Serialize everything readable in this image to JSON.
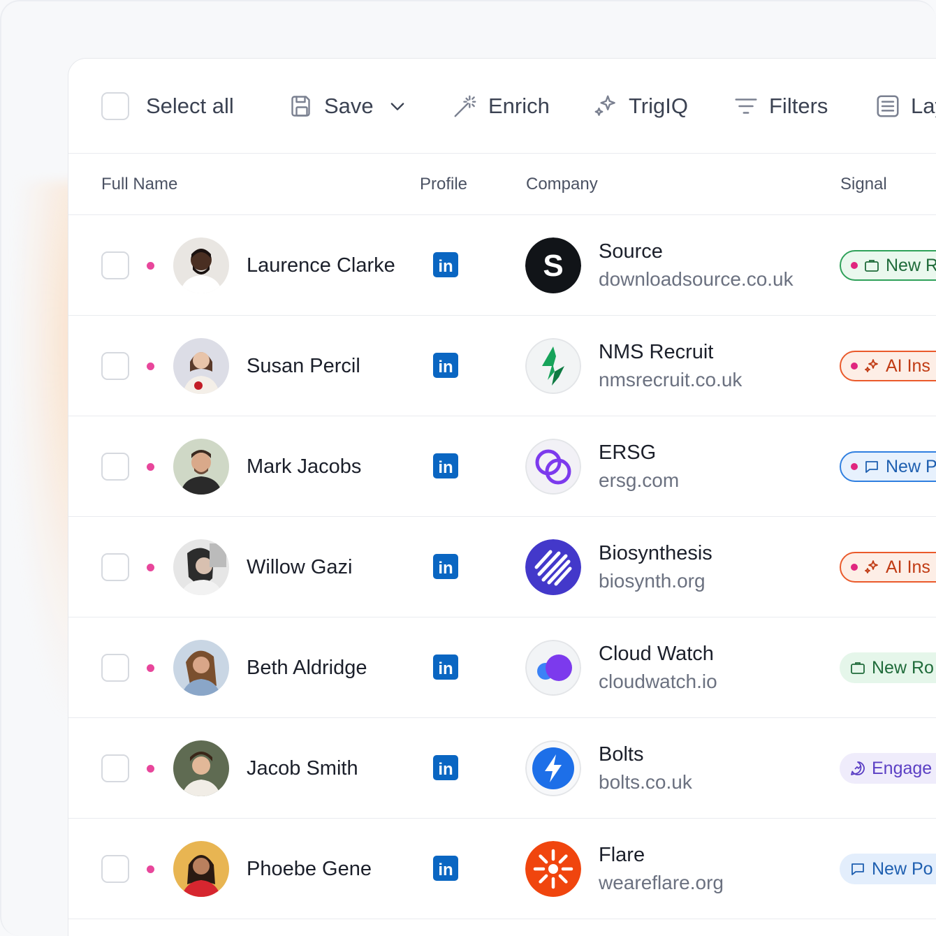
{
  "toolbar": {
    "select_all": "Select all",
    "save": "Save",
    "enrich": "Enrich",
    "trigiq": "TrigIQ",
    "filters": "Filters",
    "layout": "Lay"
  },
  "columns": {
    "full_name": "Full Name",
    "profile": "Profile",
    "company": "Company",
    "signal": "Signal"
  },
  "rows": [
    {
      "name": "Laurence Clarke",
      "company": "Source",
      "domain": "downloadsource.co.uk",
      "signal": "New R"
    },
    {
      "name": "Susan Percil",
      "company": "NMS Recruit",
      "domain": "nmsrecruit.co.uk",
      "signal": "AI Ins"
    },
    {
      "name": "Mark Jacobs",
      "company": "ERSG",
      "domain": "ersg.com",
      "signal": "New P"
    },
    {
      "name": "Willow Gazi",
      "company": "Biosynthesis",
      "domain": "biosynth.org",
      "signal": "AI Ins"
    },
    {
      "name": "Beth Aldridge",
      "company": "Cloud Watch",
      "domain": "cloudwatch.io",
      "signal": "New Ro"
    },
    {
      "name": "Jacob Smith",
      "company": "Bolts",
      "domain": "bolts.co.uk",
      "signal": "Engage"
    },
    {
      "name": "Phoebe Gene",
      "company": "Flare",
      "domain": "weareflare.org",
      "signal": "New Po"
    }
  ],
  "linkedin_text": "in",
  "source_logo_letter": "S"
}
